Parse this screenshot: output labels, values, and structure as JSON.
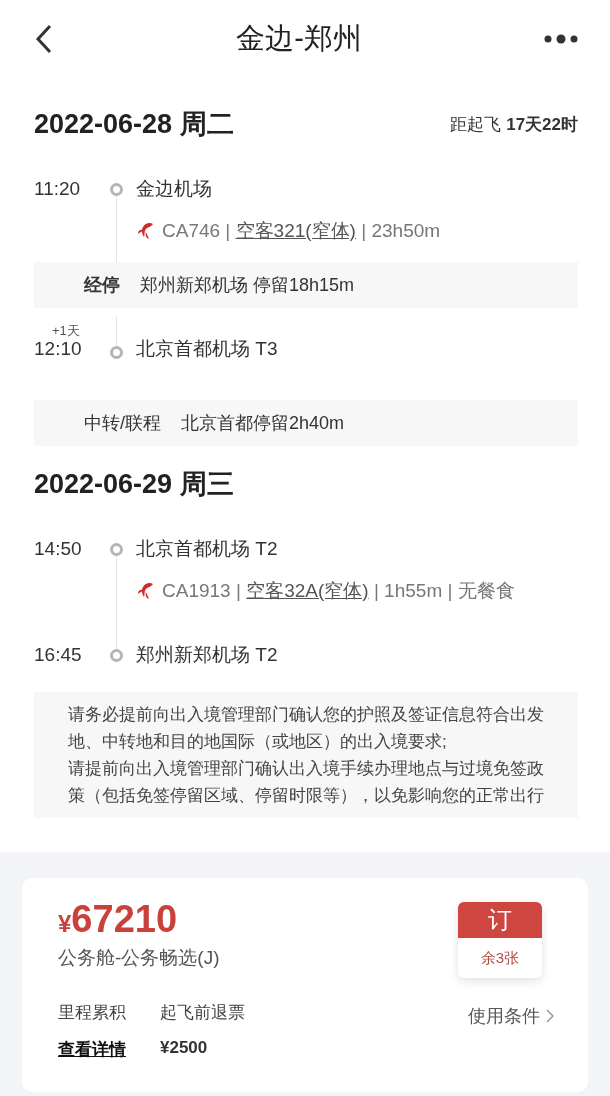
{
  "nav": {
    "title": "金边-郑州"
  },
  "itinerary": [
    {
      "kind": "date",
      "text": "2022-06-28 周二",
      "countdown": "距起飞 **17天22时**"
    },
    {
      "kind": "stop",
      "time": "11:20",
      "place": "金边机场"
    },
    {
      "kind": "flight",
      "prefix": "CA746 | ",
      "aircraft": "空客321(窄体)",
      "suffix": " | 23h50m"
    },
    {
      "kind": "stopover",
      "label": "经停",
      "text": "郑州新郑机场 停留18h15m"
    },
    {
      "kind": "stop",
      "time": "12:10",
      "place": "北京首都机场 T3",
      "day_offset": "+1天"
    },
    {
      "kind": "transfer",
      "label": "中转/联程",
      "text": "北京首都停留2h40m"
    },
    {
      "kind": "date",
      "text": "2022-06-29 周三"
    },
    {
      "kind": "stop",
      "time": "14:50",
      "place": "北京首都机场 T2"
    },
    {
      "kind": "flight",
      "prefix": "CA1913 | ",
      "aircraft": "空客32A(窄体)",
      "suffix": " | 1h55m | 无餐食"
    },
    {
      "kind": "stop",
      "time": "16:45",
      "place": "郑州新郑机场 T2"
    }
  ],
  "notice": [
    "请务必提前向出入境管理部门确认您的护照及签证信息符合出发地、中转地和目的地国际（或地区）的出入境要求;",
    "请提前向出入境管理部门确认出入境手续办理地点与过境免签政策（包括免签停留区域、停留时限等），以免影响您的正常出行"
  ],
  "fare": {
    "currency": "¥",
    "amount": "67210",
    "cabin": "公务舱-公务畅选(J)",
    "book_label": "订",
    "remaining": "余3张",
    "info": [
      {
        "label": "里程累积",
        "value": "查看详情",
        "kind": "link"
      },
      {
        "label": "起飞前退票",
        "value": "¥2500",
        "kind": "value"
      }
    ],
    "conditions": "使用条件"
  }
}
